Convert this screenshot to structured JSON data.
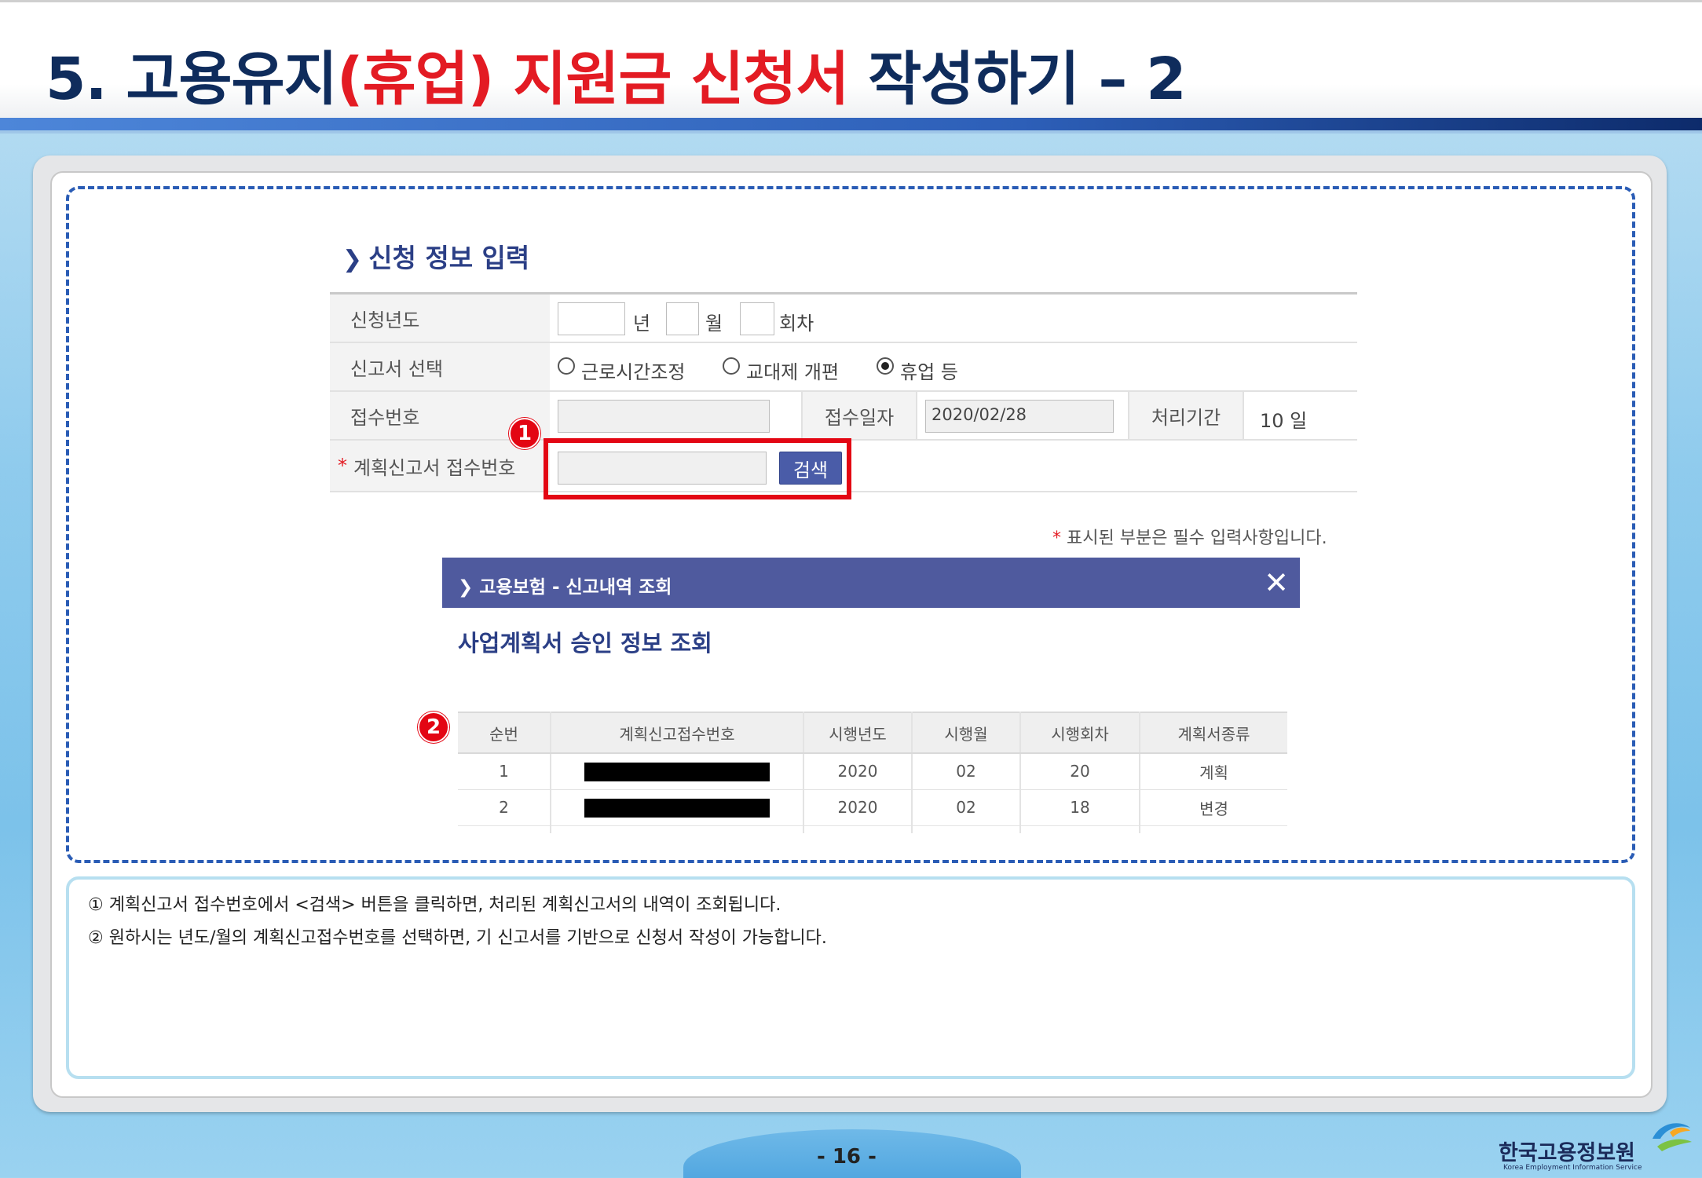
{
  "slide": {
    "title_prefix": "5. 고용유지",
    "title_highlight": "(휴업) 지원금 신청서",
    "title_suffix": " 작성하기 – 2",
    "page_number": "- 16 -",
    "logo_kr": "한국고용정보원",
    "logo_en": "Korea Employment Information Service"
  },
  "form": {
    "section_title": "신청 정보 입력",
    "rows": {
      "year_label": "신청년도",
      "year_unit": "년",
      "month_unit": "월",
      "round_unit": "회차",
      "report_label": "신고서 선택",
      "option1": "근로시간조정",
      "option2": "교대제 개편",
      "option3": "휴업 등",
      "receipt_label": "접수번호",
      "receipt_date_label": "접수일자",
      "receipt_date_value": "2020/02/28",
      "process_label": "처리기간",
      "process_value": "10 일",
      "plan_label": "계획신고서 접수번호",
      "required_mark": "*",
      "search_button": "검색"
    },
    "required_note": "표시된 부분은 필수 입력사항입니다."
  },
  "badges": {
    "one": "1",
    "two": "2"
  },
  "popup": {
    "bar_title": "고용보험 - 신고내역 조회",
    "heading": "사업계획서 승인 정보 조회",
    "columns": [
      "순번",
      "계획신고접수번호",
      "시행년도",
      "시행월",
      "시행회차",
      "계획서종류"
    ],
    "rows": [
      {
        "no": "1",
        "year": "2020",
        "month": "02",
        "round": "20",
        "type": "계획"
      },
      {
        "no": "2",
        "year": "2020",
        "month": "02",
        "round": "18",
        "type": "변경"
      }
    ]
  },
  "notes": {
    "line1": "① 계획신고서 접수번호에서 <검색> 버튼을 클릭하면, 처리된 계획신고서의 내역이 조회됩니다.",
    "line2": "② 원하시는 년도/월의 계획신고접수번호를 선택하면, 기 신고서를 기반으로 신청서 작성이 가능합니다."
  },
  "colors": {
    "accent_red": "#e30613",
    "navy": "#0f2c5c",
    "popup_bar": "#4f5a9e"
  },
  "icons": {
    "chevron": "chevron-right-icon",
    "close": "close-icon"
  }
}
